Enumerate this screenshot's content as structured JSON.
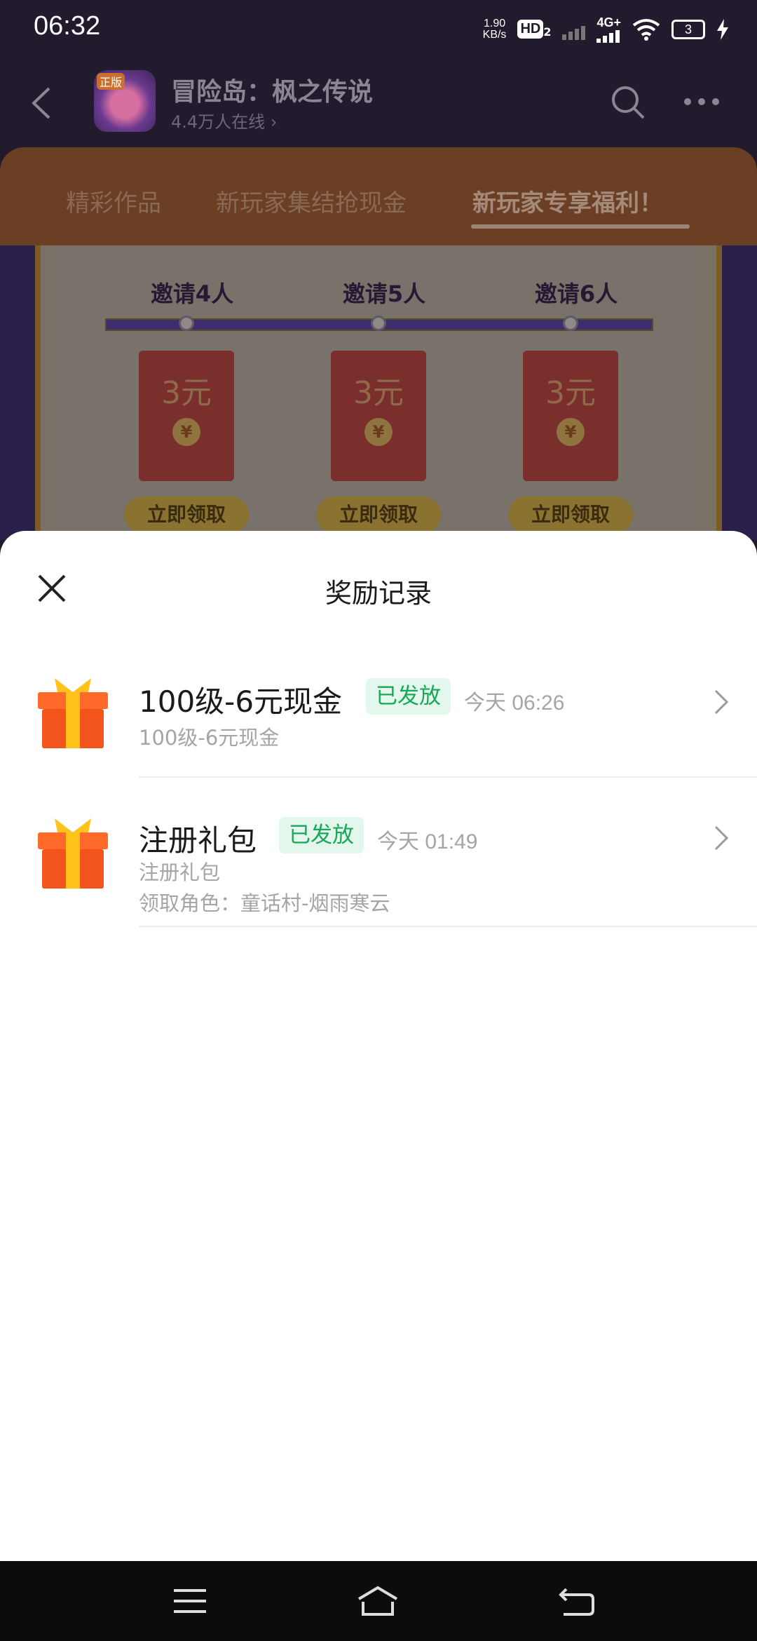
{
  "status_bar": {
    "time": "06:32",
    "net_speed_value": "1.90",
    "net_speed_unit": "KB/s",
    "hd_badge": "HD",
    "hd_sub": "2",
    "network_type": "4G+",
    "battery_level": "3"
  },
  "app_bar": {
    "game_title": "冒险岛：枫之传说",
    "online_count": "4.4万人在线",
    "logo_tag": "正版"
  },
  "tabs": [
    {
      "label": "精彩作品",
      "active": false
    },
    {
      "label": "新玩家集结抢现金",
      "active": false
    },
    {
      "label": "新玩家专享福利！",
      "active": true
    }
  ],
  "promo": {
    "rewards": [
      {
        "invite": "邀请4人",
        "amount": "3元",
        "coin": "¥",
        "button": "立即领取"
      },
      {
        "invite": "邀请5人",
        "amount": "3元",
        "coin": "¥",
        "button": "立即领取"
      },
      {
        "invite": "邀请6人",
        "amount": "3元",
        "coin": "¥",
        "button": "立即领取"
      }
    ]
  },
  "sheet": {
    "title": "奖励记录",
    "records": [
      {
        "title": "100级-6元现金",
        "status": "已发放",
        "time": "今天 06:26",
        "subtitle": "100级-6元现金",
        "role": ""
      },
      {
        "title": "注册礼包",
        "status": "已发放",
        "time": "今天 01:49",
        "subtitle": "注册礼包",
        "role": "领取角色：童话村-烟雨寒云"
      }
    ]
  },
  "colors": {
    "status_green": "#19a75a",
    "status_green_bg": "#e4f7ec",
    "gift_orange": "#f2541b",
    "gift_ribbon": "#ffc21a"
  }
}
